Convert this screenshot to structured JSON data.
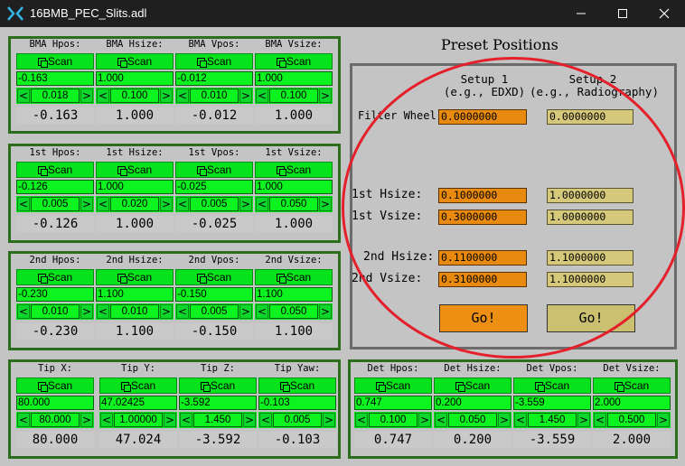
{
  "window": {
    "title": "16BMB_PEC_Slits.adl",
    "minimize": "minimize",
    "maximize": "maximize",
    "close": "close"
  },
  "scan_label": "Scan",
  "tweak_left": "<",
  "tweak_right": ">",
  "blocks": [
    {
      "name": "bma",
      "cols": [
        {
          "label": "BMA Hpos:",
          "value": "-0.163",
          "tweak": "0.018",
          "readback": "-0.163"
        },
        {
          "label": "BMA Hsize:",
          "value": "1.000",
          "tweak": "0.100",
          "readback": "1.000"
        },
        {
          "label": "BMA Vpos:",
          "value": "-0.012",
          "tweak": "0.010",
          "readback": "-0.012"
        },
        {
          "label": "BMA Vsize:",
          "value": "1.000",
          "tweak": "0.100",
          "readback": "1.000"
        }
      ]
    },
    {
      "name": "first",
      "cols": [
        {
          "label": "1st Hpos:",
          "value": "-0.126",
          "tweak": "0.005",
          "readback": "-0.126"
        },
        {
          "label": "1st Hsize:",
          "value": "1.000",
          "tweak": "0.020",
          "readback": "1.000"
        },
        {
          "label": "1st Vpos:",
          "value": "-0.025",
          "tweak": "0.005",
          "readback": "-0.025"
        },
        {
          "label": "1st Vsize:",
          "value": "1.000",
          "tweak": "0.050",
          "readback": "1.000"
        }
      ]
    },
    {
      "name": "second",
      "cols": [
        {
          "label": "2nd Hpos:",
          "value": "-0.230",
          "tweak": "0.010",
          "readback": "-0.230"
        },
        {
          "label": "2nd Hsize:",
          "value": "1.100",
          "tweak": "0.010",
          "readback": "1.100"
        },
        {
          "label": "2nd Vpos:",
          "value": "-0.150",
          "tweak": "0.005",
          "readback": "-0.150"
        },
        {
          "label": "2nd Vsize:",
          "value": "1.100",
          "tweak": "0.050",
          "readback": "1.100"
        }
      ]
    },
    {
      "name": "tip",
      "cols": [
        {
          "label": "Tip X:",
          "value": "80.000",
          "tweak": "80.000",
          "readback": "80.000"
        },
        {
          "label": "Tip Y:",
          "value": "47.02425",
          "tweak": "1.00000",
          "readback": "47.024"
        },
        {
          "label": "Tip Z:",
          "value": "-3.592",
          "tweak": "1.450",
          "readback": "-3.592"
        },
        {
          "label": "Tip Yaw:",
          "value": "-0.103",
          "tweak": "0.005",
          "readback": "-0.103"
        }
      ]
    },
    {
      "name": "det",
      "cols": [
        {
          "label": "Det Hpos:",
          "value": "0.747",
          "tweak": "0.100",
          "readback": "0.747"
        },
        {
          "label": "Det Hsize:",
          "value": "0.200",
          "tweak": "0.050",
          "readback": "0.200"
        },
        {
          "label": "Det Vpos:",
          "value": "-3.559",
          "tweak": "1.450",
          "readback": "-3.559"
        },
        {
          "label": "Det Vsize:",
          "value": "2.000",
          "tweak": "0.500",
          "readback": "2.000"
        }
      ]
    }
  ],
  "preset": {
    "title": "Preset Positions",
    "setup1_title": "Setup 1",
    "setup1_sub": "(e.g., EDXD)",
    "setup2_title": "Setup 2",
    "setup2_sub": "(e.g., Radiography)",
    "rows": [
      {
        "label": "Filter Wheel:",
        "setup1": "0.0000000",
        "setup2": "0.0000000"
      },
      {
        "label": "1st Hsize:",
        "setup1": "0.1000000",
        "setup2": "1.0000000"
      },
      {
        "label": "1st Vsize:",
        "setup1": "0.3000000",
        "setup2": "1.0000000"
      },
      {
        "label": "2nd Hsize:",
        "setup1": "0.1100000",
        "setup2": "1.1000000"
      },
      {
        "label": "2nd Vsize:",
        "setup1": "0.3100000",
        "setup2": "1.1000000"
      }
    ],
    "go1": "Go!",
    "go2": "Go!"
  },
  "colors": {
    "titlebar": "#1f1f1f",
    "background": "#c4c4c4",
    "frame_green": "#2d6e1d",
    "control_green": "#06e31c",
    "setup1_orange": "#e98a10",
    "setup2_tan": "#d5c87a",
    "annotation_red": "#e4202a"
  }
}
